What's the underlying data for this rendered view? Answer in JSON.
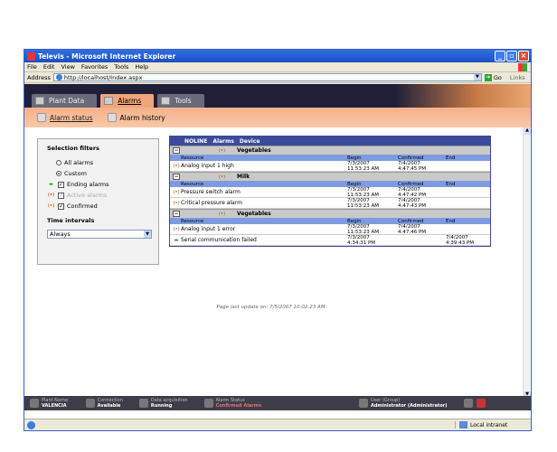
{
  "window": {
    "title": "Televis - Microsoft Internet Explorer"
  },
  "menu": [
    "File",
    "Edit",
    "View",
    "Favorites",
    "Tools",
    "Help"
  ],
  "address": {
    "label": "Address",
    "url": "http://localhost/Index.aspx",
    "go": "Go",
    "links": "Links"
  },
  "tabs": [
    {
      "label": "Plant Data",
      "icon": "plant-data-icon",
      "active": false
    },
    {
      "label": "Alarms",
      "icon": "alarms-icon",
      "active": true
    },
    {
      "label": "Tools",
      "icon": "tools-icon",
      "active": false
    }
  ],
  "subnav": [
    {
      "label": "Alarm status",
      "icon": "alarm-status-icon",
      "active": true
    },
    {
      "label": "Alarm history",
      "icon": "alarm-history-icon",
      "active": false
    }
  ],
  "filters": {
    "title": "Selection filters",
    "radio_all": "All alarms",
    "radio_custom": "Custom",
    "radio_selected": "custom",
    "check_ending": "Ending alarms",
    "check_active": "Active alarms",
    "check_confirmed": "Confirmed",
    "time_title": "Time intervals",
    "time_value": "Always"
  },
  "grid": {
    "header": {
      "noline": "NOLINE",
      "alarms": "Alarms",
      "device": "Device"
    },
    "columns": {
      "resource": "Resource",
      "begin": "Begin",
      "confirmed": "Confirmed",
      "end": "End"
    },
    "groups": [
      {
        "device": "Vegetables",
        "rows": [
          {
            "icon": "confirmed",
            "resource": "Analog input 1 high",
            "begin_date": "7/3/2007",
            "begin_time": "11:53:23 AM",
            "conf_date": "7/4/2007",
            "conf_time": "4:47:45 PM",
            "end_date": "",
            "end_time": ""
          }
        ]
      },
      {
        "device": "Milk",
        "rows": [
          {
            "icon": "confirmed",
            "resource": "Pressure switch alarm",
            "begin_date": "7/3/2007",
            "begin_time": "11:53:23 AM",
            "conf_date": "7/4/2007",
            "conf_time": "4:47:42 PM",
            "end_date": "",
            "end_time": ""
          },
          {
            "icon": "confirmed",
            "resource": "Critical pressure alarm",
            "begin_date": "7/3/2007",
            "begin_time": "11:53:23 AM",
            "conf_date": "7/4/2007",
            "conf_time": "4:47:43 PM",
            "end_date": "",
            "end_time": ""
          }
        ]
      },
      {
        "device": "Vegetables",
        "rows": [
          {
            "icon": "confirmed",
            "resource": "Analog input 1 error",
            "begin_date": "7/3/2007",
            "begin_time": "11:53:23 AM",
            "conf_date": "7/4/2007",
            "conf_time": "4:47:46 PM",
            "end_date": "",
            "end_time": ""
          },
          {
            "icon": "ending",
            "resource": "Serial communication failed",
            "begin_date": "7/3/2007",
            "begin_time": "4:34:31 PM",
            "conf_date": "",
            "conf_time": "",
            "end_date": "7/4/2007",
            "end_time": "4:39:43 PM"
          }
        ]
      }
    ]
  },
  "last_update": "Page last update on: 7/5/2007 10:02:23 AM",
  "status": {
    "plant_label": "Plant Name:",
    "plant_value": "VALENCIA",
    "conn_label": "Connection",
    "conn_value": "Available",
    "acq_label": "Data acquisition",
    "acq_value": "Running",
    "alarm_label": "Alarm Status",
    "alarm_value": "Confirmed Alarms",
    "user_label": "User (Group)",
    "user_value": "Administrator (Administrator)"
  },
  "ie_status": {
    "zone": "Local intranet"
  },
  "colors": {
    "titlebar": "#1b4fc2",
    "app_header": "#1f1f3a",
    "accent": "#f0a57a",
    "grid_header": "#3b4a9a"
  }
}
